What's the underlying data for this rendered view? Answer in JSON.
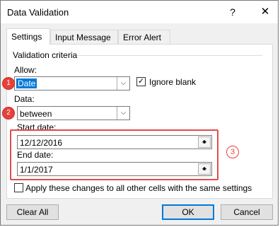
{
  "window": {
    "title": "Data Validation",
    "help_glyph": "?",
    "close_glyph": "✕"
  },
  "tabs": [
    {
      "label": "Settings",
      "active": true
    },
    {
      "label": "Input Message",
      "active": false
    },
    {
      "label": "Error Alert",
      "active": false
    }
  ],
  "criteria": {
    "group_label": "Validation criteria",
    "allow_label": "Allow:",
    "allow_value": "Date",
    "ignore_blank_label": "Ignore blank",
    "ignore_blank_checked": true,
    "data_label": "Data:",
    "data_value": "between",
    "start_date_label": "Start date:",
    "start_date_value": "12/12/2016",
    "end_date_label": "End date:",
    "end_date_value": "1/1/2017"
  },
  "apply_label": "Apply these changes to all other cells with the same settings",
  "apply_checked": false,
  "buttons": {
    "clear_all": "Clear All",
    "ok": "OK",
    "cancel": "Cancel"
  },
  "markers": [
    "1",
    "2",
    "3"
  ],
  "colors": {
    "accent": "#0078d7",
    "marker": "#e8413a",
    "highlight": "#e24b4b"
  }
}
